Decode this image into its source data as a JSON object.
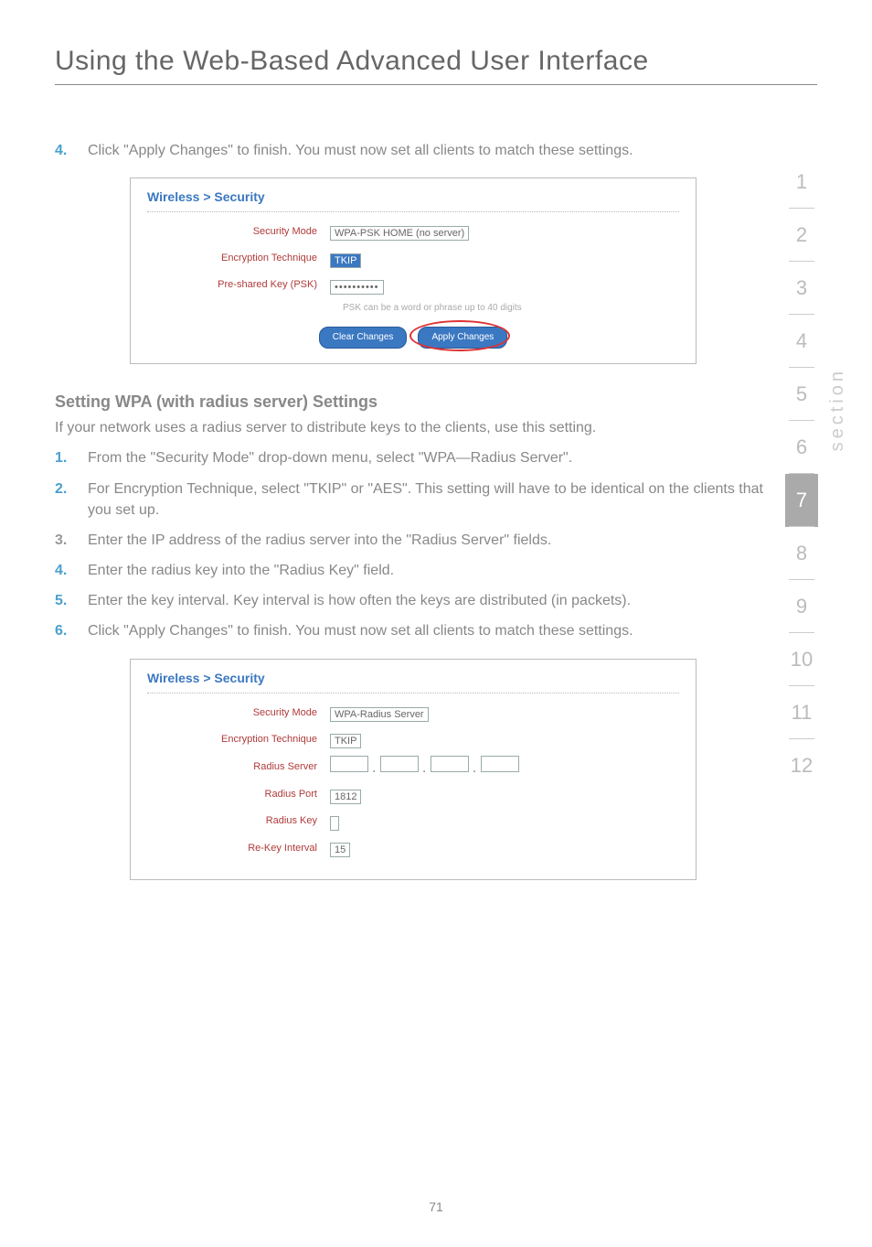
{
  "header": {
    "title": "Using the Web-Based Advanced User Interface"
  },
  "sidebar": {
    "section_label": "section",
    "items": [
      "1",
      "2",
      "3",
      "4",
      "5",
      "6",
      "7",
      "8",
      "9",
      "10",
      "11",
      "12"
    ],
    "active_index": 6
  },
  "step_top": {
    "num": "4.",
    "text": "Click \"Apply Changes\" to finish. You must now set all clients to match these settings."
  },
  "panel1": {
    "title": "Wireless > Security",
    "rows": {
      "mode_label": "Security Mode",
      "mode_value": "WPA-PSK HOME (no server)",
      "enc_label": "Encryption Technique",
      "enc_value": "TKIP",
      "psk_label": "Pre-shared Key (PSK)",
      "psk_value": "••••••••••",
      "hint": "PSK can be a word or phrase up to 40 digits"
    },
    "btn_clear": "Clear Changes",
    "btn_apply": "Apply Changes"
  },
  "wpa_heading": "Setting WPA (with radius server) Settings",
  "wpa_intro": "If your network uses a radius server to distribute keys to the clients, use this setting.",
  "steps": [
    {
      "num": "1.",
      "text": "From the \"Security Mode\" drop-down menu, select \"WPA—Radius Server\"."
    },
    {
      "num": "2.",
      "text": "For Encryption Technique, select \"TKIP\" or \"AES\". This setting will have to be identical on the clients that you set up."
    },
    {
      "num": "3.",
      "text": "Enter the IP address of the radius server into the \"Radius Server\" fields."
    },
    {
      "num": "4.",
      "text": "Enter the radius key into the \"Radius Key\" field."
    },
    {
      "num": "5.",
      "text": "Enter the key interval. Key interval is how often the keys are distributed (in packets)."
    },
    {
      "num": "6.",
      "text": "Click \"Apply Changes\" to finish. You must now set all clients to match these settings."
    }
  ],
  "panel2": {
    "title": "Wireless > Security",
    "rows": {
      "mode_label": "Security Mode",
      "mode_value": "WPA-Radius Server",
      "enc_label": "Encryption Technique",
      "enc_value": "TKIP",
      "srv_label": "Radius Server",
      "port_label": "Radius Port",
      "port_value": "1812",
      "key_label": "Radius Key",
      "key_value": "",
      "rekey_label": "Re-Key Interval",
      "rekey_value": "15"
    }
  },
  "page_number": "71"
}
